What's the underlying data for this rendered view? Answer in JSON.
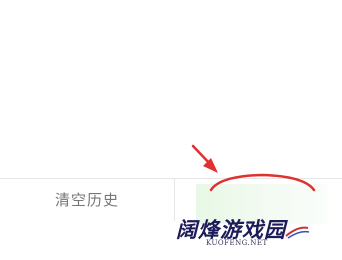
{
  "main": {
    "bottom_bar": {
      "clear_history_label": "清空历史",
      "confirm_label": ""
    }
  },
  "watermark": {
    "brand": "阔烽游戏园",
    "url": "KUOFENG.NET"
  },
  "colors": {
    "annotation": "#e03030",
    "button_bg": "#e8f8e6",
    "text_gray": "#777777"
  }
}
